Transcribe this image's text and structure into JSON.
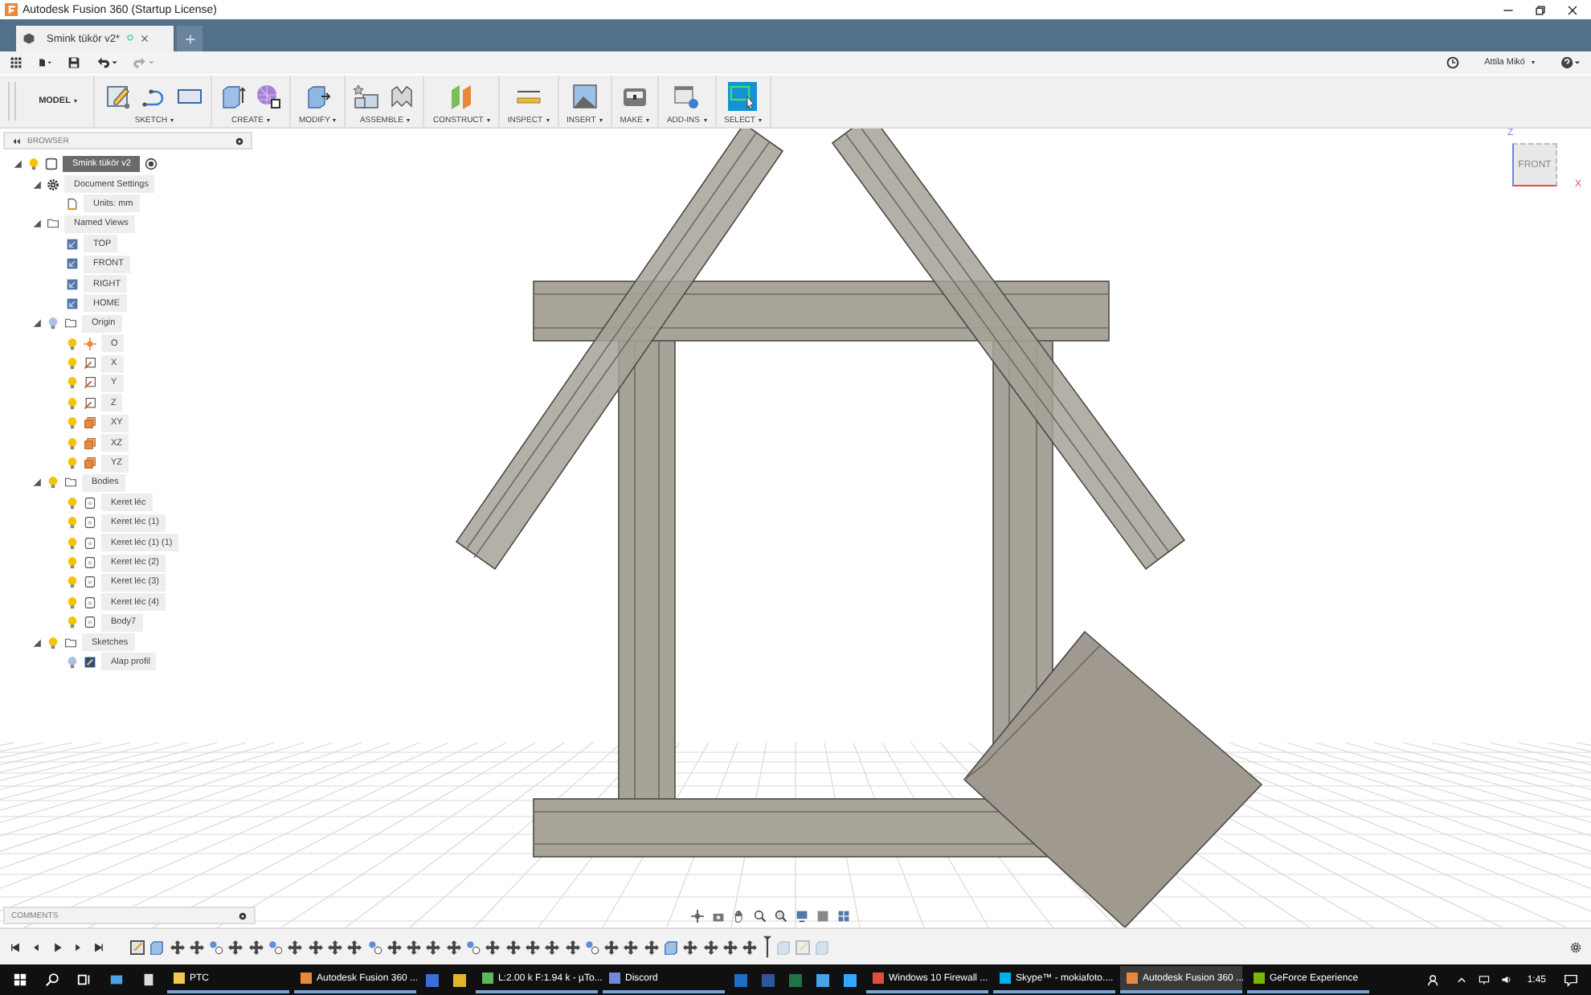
{
  "window": {
    "title": "Autodesk Fusion 360 (Startup License)"
  },
  "tabs": [
    {
      "label": "Smink tükör v2*",
      "selected": true
    }
  ],
  "quickbar": {
    "user": "Attila Mikó"
  },
  "ribbon": {
    "workspace": "MODEL",
    "groups": [
      {
        "label": "SKETCH",
        "tools": [
          {
            "kind": "sketch"
          },
          {
            "kind": "arc"
          },
          {
            "kind": "rectangle"
          }
        ]
      },
      {
        "label": "CREATE",
        "tools": [
          {
            "kind": "box"
          },
          {
            "kind": "form"
          }
        ]
      },
      {
        "label": "MODIFY",
        "tools": [
          {
            "kind": "presspull"
          }
        ]
      },
      {
        "label": "ASSEMBLE",
        "tools": [
          {
            "kind": "component"
          },
          {
            "kind": "joint"
          }
        ]
      },
      {
        "label": "CONSTRUCT",
        "tools": [
          {
            "kind": "plane"
          }
        ]
      },
      {
        "label": "INSPECT",
        "tools": [
          {
            "kind": "measure"
          }
        ]
      },
      {
        "label": "INSERT",
        "tools": [
          {
            "kind": "image"
          }
        ]
      },
      {
        "label": "MAKE",
        "tools": [
          {
            "kind": "print"
          }
        ]
      },
      {
        "label": "ADD-INS",
        "tools": [
          {
            "kind": "script"
          }
        ]
      },
      {
        "label": "SELECT",
        "tools": [
          {
            "kind": "select"
          }
        ]
      }
    ]
  },
  "browser": {
    "title": "BROWSER",
    "tree": {
      "label": "Smink tükör v2",
      "kind": "component",
      "visible": true,
      "expanded": true,
      "active": true,
      "children": [
        {
          "label": "Document Settings",
          "kind": "settings",
          "expanded": true,
          "children": [
            {
              "label": "Units: mm",
              "kind": "units"
            }
          ]
        },
        {
          "label": "Named Views",
          "kind": "folder",
          "expanded": true,
          "children": [
            {
              "label": "TOP",
              "kind": "view"
            },
            {
              "label": "FRONT",
              "kind": "view"
            },
            {
              "label": "RIGHT",
              "kind": "view"
            },
            {
              "label": "HOME",
              "kind": "view"
            }
          ]
        },
        {
          "label": "Origin",
          "kind": "folder",
          "visible": false,
          "expanded": true,
          "children": [
            {
              "label": "O",
              "kind": "point",
              "visible": true
            },
            {
              "label": "X",
              "kind": "axis",
              "visible": true
            },
            {
              "label": "Y",
              "kind": "axis",
              "visible": true
            },
            {
              "label": "Z",
              "kind": "axis",
              "visible": true
            },
            {
              "label": "XY",
              "kind": "plane",
              "visible": true
            },
            {
              "label": "XZ",
              "kind": "plane",
              "visible": true
            },
            {
              "label": "YZ",
              "kind": "plane",
              "visible": true
            }
          ]
        },
        {
          "label": "Bodies",
          "kind": "folder",
          "visible": true,
          "expanded": true,
          "children": [
            {
              "label": "Keret léc",
              "kind": "body",
              "visible": true
            },
            {
              "label": "Keret léc (1)",
              "kind": "body",
              "visible": true
            },
            {
              "label": "Keret léc (1) (1)",
              "kind": "body",
              "visible": true
            },
            {
              "label": "Keret léc (2)",
              "kind": "body",
              "visible": true
            },
            {
              "label": "Keret léc (3)",
              "kind": "body",
              "visible": true
            },
            {
              "label": "Keret léc (4)",
              "kind": "body",
              "visible": true
            },
            {
              "label": "Body7",
              "kind": "body",
              "visible": true
            }
          ]
        },
        {
          "label": "Sketches",
          "kind": "folder",
          "visible": true,
          "expanded": true,
          "children": [
            {
              "label": "Alap profil",
              "kind": "sketch",
              "visible": false
            }
          ]
        }
      ]
    }
  },
  "viewcube": {
    "face": "FRONT",
    "axes": [
      "Z",
      "X"
    ]
  },
  "comments": {
    "title": "COMMENTS"
  },
  "timeline": {
    "features": [
      {
        "kind": "sketch",
        "rolled_back": false
      },
      {
        "kind": "extrude",
        "rolled_back": false
      },
      {
        "kind": "move",
        "rolled_back": false
      },
      {
        "kind": "move",
        "rolled_back": false
      },
      {
        "kind": "joint",
        "rolled_back": false
      },
      {
        "kind": "move",
        "rolled_back": false
      },
      {
        "kind": "move",
        "rolled_back": false
      },
      {
        "kind": "joint",
        "rolled_back": false
      },
      {
        "kind": "move",
        "rolled_back": false
      },
      {
        "kind": "move",
        "rolled_back": false
      },
      {
        "kind": "move",
        "rolled_back": false
      },
      {
        "kind": "move",
        "rolled_back": false
      },
      {
        "kind": "joint",
        "rolled_back": false
      },
      {
        "kind": "move",
        "rolled_back": false
      },
      {
        "kind": "move",
        "rolled_back": false
      },
      {
        "kind": "move",
        "rolled_back": false
      },
      {
        "kind": "move",
        "rolled_back": false
      },
      {
        "kind": "joint",
        "rolled_back": false
      },
      {
        "kind": "move",
        "rolled_back": false
      },
      {
        "kind": "move",
        "rolled_back": false
      },
      {
        "kind": "move",
        "rolled_back": false
      },
      {
        "kind": "move",
        "rolled_back": false
      },
      {
        "kind": "move",
        "rolled_back": false
      },
      {
        "kind": "joint",
        "rolled_back": false
      },
      {
        "kind": "move",
        "rolled_back": false
      },
      {
        "kind": "move",
        "rolled_back": false
      },
      {
        "kind": "move",
        "rolled_back": false
      },
      {
        "kind": "extrude",
        "rolled_back": false
      },
      {
        "kind": "move",
        "rolled_back": false
      },
      {
        "kind": "move",
        "rolled_back": false
      },
      {
        "kind": "move",
        "rolled_back": false
      },
      {
        "kind": "move",
        "rolled_back": false
      },
      {
        "kind": "extrude",
        "rolled_back": true
      },
      {
        "kind": "sketch",
        "rolled_back": true
      },
      {
        "kind": "extrude",
        "rolled_back": true
      }
    ]
  },
  "taskbar": {
    "items": [
      {
        "kind": "labeled",
        "label": "PTC",
        "color": "#f2c94c",
        "selected": false
      },
      {
        "kind": "labeled",
        "label": "Autodesk Fusion 360 ...",
        "color": "#e8883a",
        "selected": false
      },
      {
        "kind": "icon",
        "color": "#3a6fd8",
        "selected": false
      },
      {
        "kind": "icon",
        "color": "#e0b52c",
        "selected": false
      },
      {
        "kind": "labeled",
        "label": "L:2.00 k F:1.94 k - µTo...",
        "color": "#5cb85c",
        "selected": false
      },
      {
        "kind": "labeled",
        "label": "Discord",
        "color": "#7289da",
        "selected": false
      },
      {
        "kind": "icon",
        "color": "#1e6fc5",
        "selected": false
      },
      {
        "kind": "icon",
        "color": "#2b579a",
        "selected": false
      },
      {
        "kind": "icon",
        "color": "#217346",
        "selected": false
      },
      {
        "kind": "icon",
        "color": "#4aa3e6",
        "selected": false
      },
      {
        "kind": "icon",
        "color": "#31a8ff",
        "selected": false
      },
      {
        "kind": "labeled",
        "label": "Windows 10 Firewall ...",
        "color": "#e04e39",
        "selected": false
      },
      {
        "kind": "labeled",
        "label": "Skype™ - mokiafoto....",
        "color": "#00aff0",
        "selected": false
      },
      {
        "kind": "labeled",
        "label": "Autodesk Fusion 360 ...",
        "color": "#e8883a",
        "selected": true
      },
      {
        "kind": "labeled",
        "label": "GeForce Experience",
        "color": "#76b900",
        "selected": false
      }
    ],
    "clock": "1:45"
  }
}
